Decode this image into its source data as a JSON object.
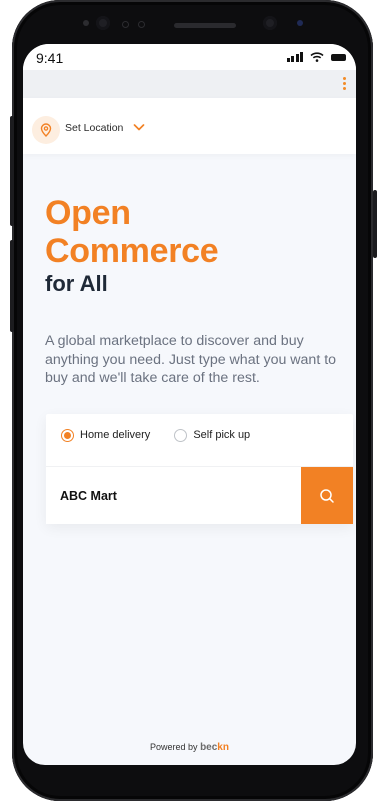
{
  "status_bar": {
    "time": "9:41"
  },
  "location": {
    "label": "Set Location"
  },
  "hero": {
    "line1": "Open",
    "line2": "Commerce",
    "line3": "for All",
    "description": "A global marketplace to discover and buy anything you need. Just type what you want to buy and we'll take care of the rest."
  },
  "delivery": {
    "options": [
      {
        "label": "Home delivery",
        "selected": true
      },
      {
        "label": "Self pick up",
        "selected": false
      }
    ]
  },
  "search": {
    "value": "ABC Mart"
  },
  "footer": {
    "powered_by": "Powered by",
    "brand_main": "bec",
    "brand_accent": "kn"
  },
  "colors": {
    "accent": "#f28124",
    "dark_text": "#1f2937",
    "muted_text": "#6b7280",
    "background": "#f6f8fc"
  },
  "icons": [
    "location-pin-icon",
    "chevron-down-icon",
    "kebab-menu-icon",
    "search-icon",
    "signal-icon",
    "wifi-icon",
    "battery-icon"
  ]
}
